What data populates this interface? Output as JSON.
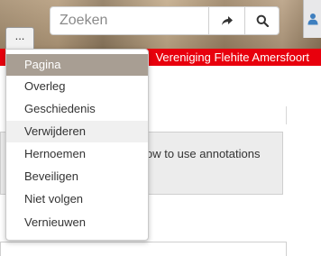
{
  "header": {
    "more_label": "...",
    "search": {
      "placeholder": "Zoeken",
      "value": ""
    },
    "go_icon": "share-arrow-icon",
    "search_icon": "magnifier-icon",
    "user_icon": "user-icon"
  },
  "banner": {
    "title": "Vereniging Flehite Amersfoort",
    "color": "#e8000d"
  },
  "background": {
    "info_text": "ow to use annotations"
  },
  "menu": {
    "active_index": 0,
    "hovered_index": 3,
    "items": [
      {
        "label": "Pagina"
      },
      {
        "label": "Overleg"
      },
      {
        "label": "Geschiedenis"
      },
      {
        "label": "Verwijderen"
      },
      {
        "label": "Hernoemen"
      },
      {
        "label": "Beveiligen"
      },
      {
        "label": "Niet volgen"
      },
      {
        "label": "Vernieuwen"
      }
    ]
  }
}
